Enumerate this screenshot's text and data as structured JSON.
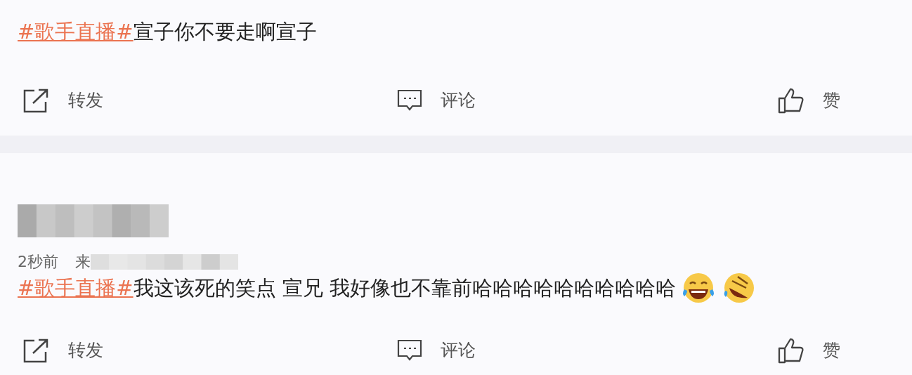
{
  "posts": [
    {
      "topic": "#歌手直播#",
      "text": "宣子你不要走啊宣子",
      "actions": [
        {
          "kind": "repost",
          "label": "转发"
        },
        {
          "kind": "comment",
          "label": "评论"
        },
        {
          "kind": "like",
          "label": "赞"
        }
      ]
    },
    {
      "author_blurred": true,
      "time": "2秒前",
      "source": "来",
      "source_blurred": true,
      "topic": "#歌手直播#",
      "text": "我这该死的笑点 宣兄 我好像也不靠前哈哈哈哈哈哈哈哈哈哈",
      "emojis": [
        {
          "kind": "tears-of-joy"
        },
        {
          "kind": "rolling-laugh"
        }
      ],
      "actions": [
        {
          "kind": "repost",
          "label": "转发"
        },
        {
          "kind": "comment",
          "label": "评论"
        },
        {
          "kind": "like",
          "label": "赞"
        }
      ]
    }
  ]
}
